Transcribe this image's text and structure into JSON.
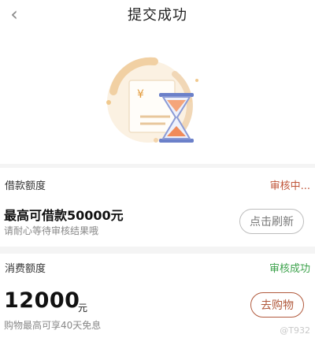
{
  "nav": {
    "back_icon": "chevron-left-icon",
    "title": "提交成功"
  },
  "hero": {
    "illustration": "hourglass-document-illustration",
    "currency_symbol": "¥"
  },
  "loan_card": {
    "label": "借款额度",
    "status": "审核中...",
    "headline": "最高可借款50000元",
    "subtitle": "请耐心等待审核结果哦",
    "button": "点击刷新"
  },
  "consume_card": {
    "label": "消费额度",
    "status": "审核成功",
    "amount": "12000",
    "unit": "元",
    "subtitle": "购物最高可享40天免息",
    "button": "去购物"
  },
  "watermark": "@T932",
  "colors": {
    "pending": "#c0563a",
    "success": "#3ca24b",
    "accent": "#b15a3d",
    "background": "#f4f4f4"
  }
}
